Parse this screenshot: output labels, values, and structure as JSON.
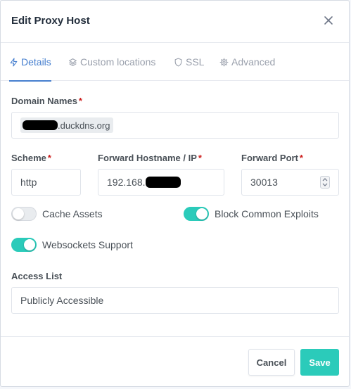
{
  "modal": {
    "title": "Edit Proxy Host"
  },
  "tabs": [
    {
      "label": "Details",
      "icon": "lightning-icon",
      "active": true
    },
    {
      "label": "Custom locations",
      "icon": "layers-icon",
      "active": false
    },
    {
      "label": "SSL",
      "icon": "shield-icon",
      "active": false
    },
    {
      "label": "Advanced",
      "icon": "gear-icon",
      "active": false
    }
  ],
  "form": {
    "domain_names": {
      "label": "Domain Names",
      "required_mark": "*",
      "value_suffix": ".duckdns.org"
    },
    "scheme": {
      "label": "Scheme",
      "required_mark": "*",
      "value": "http"
    },
    "forward_hostname": {
      "label": "Forward Hostname / IP",
      "required_mark": "*",
      "value_prefix": "192.168."
    },
    "forward_port": {
      "label": "Forward Port",
      "required_mark": "*",
      "value": "30013"
    },
    "cache_assets": {
      "label": "Cache Assets",
      "enabled": false
    },
    "block_common_exploits": {
      "label": "Block Common Exploits",
      "enabled": true
    },
    "websockets_support": {
      "label": "Websockets Support",
      "enabled": true
    },
    "access_list": {
      "label": "Access List",
      "value": "Publicly Accessible"
    }
  },
  "footer": {
    "cancel_label": "Cancel",
    "save_label": "Save"
  },
  "colors": {
    "accent_teal": "#2bcbba",
    "tab_active_blue": "#467fcf",
    "required_red": "#cd201f"
  }
}
